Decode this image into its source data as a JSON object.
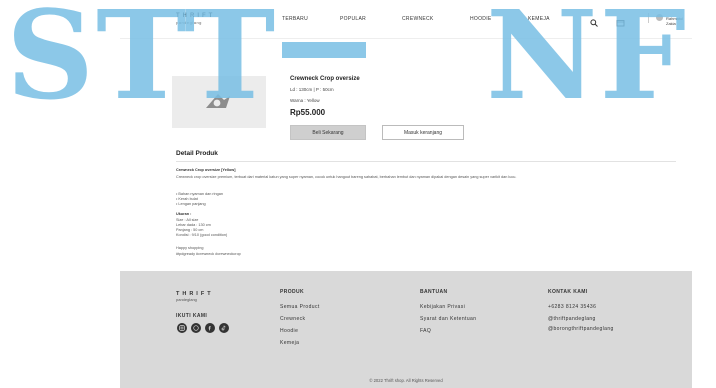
{
  "header": {
    "brand_line1": "THRIFT",
    "brand_line2": "pandeglang",
    "nav": [
      "TERBARU",
      "POPULAR",
      "CREWNECK",
      "HOODIE",
      "KEMEJA"
    ],
    "user_name": "Rahmatul Zakia"
  },
  "product": {
    "title": "Crewneck Crop oversize",
    "size": "Ld : 130cm | P : 50cm",
    "color": "Warna : Yellow",
    "price": "Rp55.000",
    "buy_label": "Beli Sekarang",
    "cart_label": "Masuk keranjang"
  },
  "detail": {
    "heading": "Detail Produk",
    "name_line": "Crewneck Crop oversize [Yellow]",
    "desc": "Crewneck crop oversize premium, terbuat dari material katun yang super nyaman, cocok untuk hangout bareng sahabat, berbahan lembut dan nyaman dipakai dengan desain yang super varikit dan lucu.",
    "bullets": [
      "• Bahan nyaman dan ringan",
      "• Kerah bulat",
      "• Lengan panjang"
    ],
    "size_head": "Ukuran :",
    "size_rows": [
      "Size          : All size",
      "Lebar dada : 130 cm",
      "Panjang     : 50 cm",
      "Kondisi      : 9/10 (good condition)"
    ],
    "tag1": "Happy shopping",
    "tag2": "#tpdgready #crewneck #crewneckcrop"
  },
  "footer": {
    "brand_line1": "THRIFT",
    "brand_line2": "pandeglang",
    "follow": "IKUTI KAMI",
    "produk_head": "PRODUK",
    "produk_items": [
      "Semua Product",
      "Crewneck",
      "Hoodie",
      "Kemeja"
    ],
    "bantuan_head": "BANTUAN",
    "bantuan_items": [
      "Kebijakan Privasi",
      "Syarat dan Ketentuan",
      "FAQ"
    ],
    "kontak_head": "KONTAK KAMI",
    "kontak_items": [
      "+6283 8124 35436",
      "@thriftpandeglang",
      "@borongthriftpandeglang"
    ],
    "copyright": "© 2022 Thrift shop. All Rights Reserved"
  },
  "watermark": {
    "left": "STT",
    "right": "NF"
  },
  "icons": [
    "search-icon",
    "cart-icon",
    "user-avatar",
    "instagram-icon",
    "whatsapp-icon",
    "facebook-icon",
    "tiktok-icon"
  ],
  "colors": {
    "footer_bg": "#d9d9d9",
    "button_bg": "#cfcfcf",
    "watermark": "#78bee4"
  }
}
